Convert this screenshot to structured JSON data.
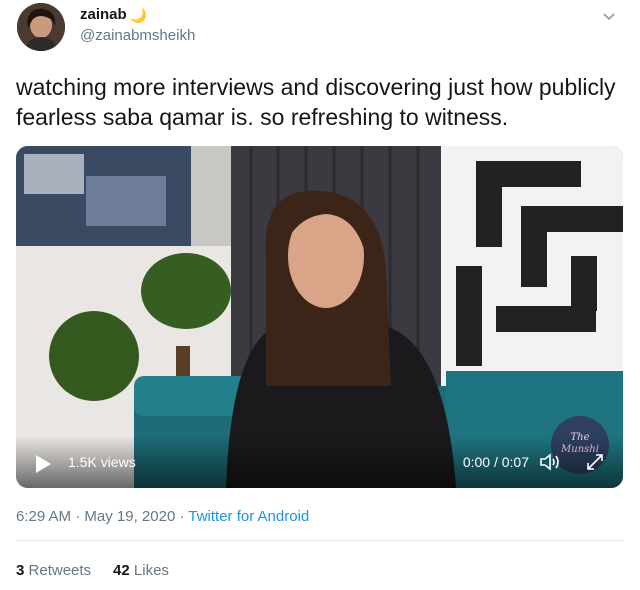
{
  "user": {
    "display_name": "zainab",
    "handle": "@zainabmsheikh",
    "name_emoji": "🌙"
  },
  "tweet": {
    "text": "watching more interviews and discovering just how publicly fearless saba qamar is. so refreshing to witness."
  },
  "video": {
    "views": "1.5K views",
    "time": "0:00 / 0:07",
    "watermark": "The Munshi",
    "progress": 0
  },
  "meta": {
    "time": "6:29 AM",
    "sep1": " · ",
    "date": "May 19, 2020",
    "sep2": " · ",
    "source": "Twitter for Android"
  },
  "stats": {
    "retweets_count": "3",
    "retweets_label": "Retweets",
    "likes_count": "42",
    "likes_label": "Likes"
  },
  "colors": {
    "link": "#1b95e0",
    "secondary_text": "#657786",
    "primary_text": "#14171a"
  },
  "icons": [
    "caret-down-icon",
    "play-icon",
    "volume-icon",
    "fullscreen-icon"
  ]
}
